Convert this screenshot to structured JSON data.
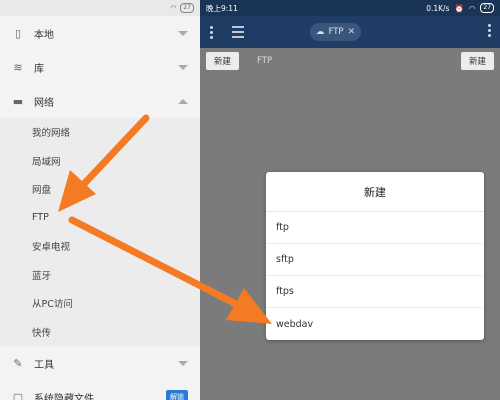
{
  "left_status": {
    "left_text": "",
    "right_text": "",
    "battery": "27"
  },
  "drawer": {
    "items": [
      {
        "label": "本地",
        "icon": "phone-icon"
      },
      {
        "label": "库",
        "icon": "layers-icon"
      },
      {
        "label": "网络",
        "icon": "network-icon"
      }
    ],
    "network_sub": [
      "我的网络",
      "局域网",
      "网盘",
      "FTP",
      "安卓电视",
      "蓝牙",
      "从PC访问",
      "快传"
    ],
    "tools_label": "工具",
    "hidden_label": "系统隐藏文件",
    "hidden_badge": "解锁"
  },
  "right_status": {
    "time": "晚上9:11",
    "speed": "0.1K/s",
    "battery": "27"
  },
  "app": {
    "tab_label": "FTP",
    "new_label_left": "新建",
    "path_label": "FTP",
    "new_label_right": "新建"
  },
  "dialog": {
    "title": "新建",
    "options": [
      "ftp",
      "sftp",
      "ftps",
      "webdav"
    ]
  },
  "colors": {
    "arrow": "#f47a24",
    "accent": "#1e3c64"
  }
}
